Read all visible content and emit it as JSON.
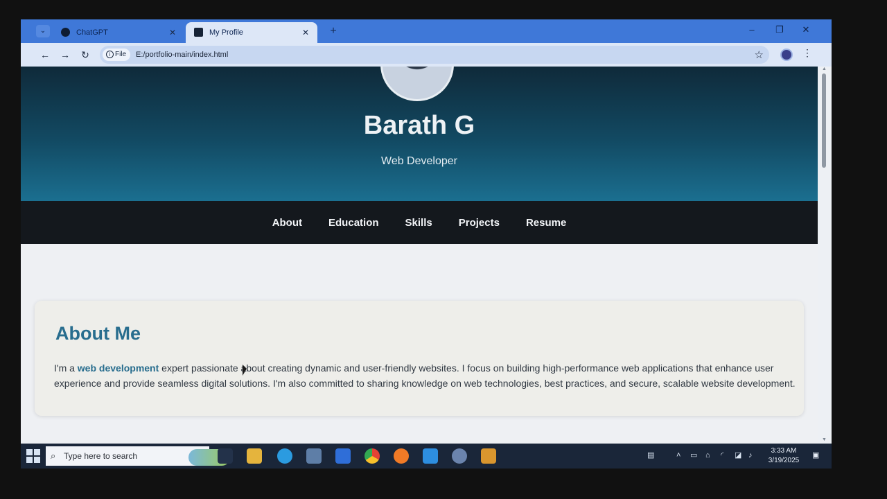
{
  "browser": {
    "tabs": [
      {
        "label": "ChatGPT",
        "active": false
      },
      {
        "label": "My Profile",
        "active": true
      }
    ],
    "tab_close": "✕",
    "new_tab": "+",
    "address": {
      "scheme_label": "File",
      "url": "E:/portfolio-main/index.html"
    },
    "window_controls": {
      "minimize": "–",
      "restore": "❐",
      "close": "✕"
    }
  },
  "page": {
    "name": "Barath G",
    "role": "Web Developer",
    "nav": [
      "About",
      "Education",
      "Skills",
      "Projects",
      "Resume"
    ],
    "about": {
      "title": "About Me",
      "text_before": "I'm a ",
      "highlight": "web development",
      "text_after": " expert passionate about creating dynamic and user-friendly websites. I focus on building high-performance web applications that enhance user experience and provide seamless digital solutions. I'm also committed to sharing knowledge on web technologies, best practices, and secure, scalable website development."
    }
  },
  "taskbar": {
    "search_placeholder": "Type here to search",
    "time": "3:33 AM",
    "date": "3/19/2025"
  },
  "colors": {
    "accent_blue": "#286d8e",
    "nav_bg": "#14181d",
    "tabstrip_bg": "#3f78d8"
  }
}
